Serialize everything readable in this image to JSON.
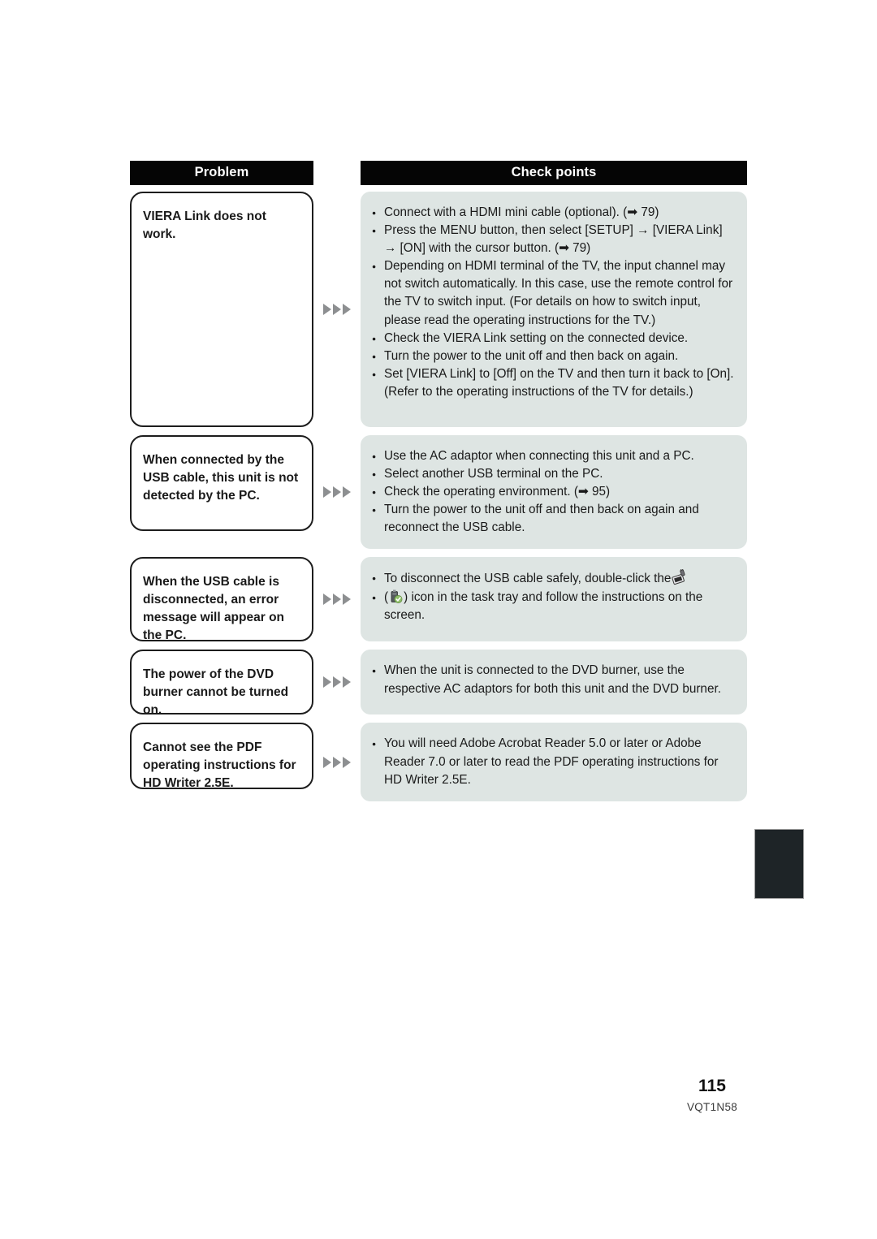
{
  "document": {
    "page_number": "115",
    "doc_code": "VQT1N58"
  },
  "table": {
    "headers": {
      "problem": "Problem",
      "check_points": "Check points"
    },
    "rows": [
      {
        "problem": "VIERA Link does not work.",
        "points": [
          "Connect with a HDMI mini cable (optional). (➡ 79)",
          "Press the MENU button, then select [SETUP] → [VIERA Link] → [ON] with the cursor button. (➡ 79)",
          "Depending on HDMI terminal of the TV, the input channel may not switch automatically. In this case, use the remote control for the TV to switch input. (For details on how to switch input, please read the operating instructions for the TV.)",
          "Check the VIERA Link setting on the connected device.",
          "Turn the power to the unit off and then back on again.",
          "Set [VIERA Link] to [Off] on the TV and then turn it back to [On]. (Refer to the operating instructions of the TV for details.)"
        ]
      },
      {
        "problem": "When connected by the USB cable, this unit is not detected by the PC.",
        "points": [
          "Use the AC adaptor when connecting this unit and a PC.",
          "Select another USB terminal on the PC.",
          "Check the operating environment. (➡ 95)",
          "Turn the power to the unit off and then back on again and reconnect the USB cable."
        ]
      },
      {
        "problem": "When the USB cable is disconnected, an error message will appear on the PC.",
        "points_split": {
          "before_icon1": "To disconnect the USB cable safely, double-click the",
          "between_icons": "(",
          "after_icon2": ") icon in the task tray and follow the instructions on the screen."
        },
        "icons": {
          "unplug": "safely-remove-hardware-icon",
          "usb_drive": "usb-drive-icon"
        }
      },
      {
        "problem": "The power of the DVD burner cannot be turned on.",
        "points": [
          "When the unit is connected to the DVD burner, use the respective AC adaptors for both this unit and the DVD burner."
        ]
      },
      {
        "problem": "Cannot see the PDF operating instructions for HD Writer 2.5E.",
        "points": [
          "You will need Adobe Acrobat Reader 5.0 or later or Adobe Reader 7.0 or later to read the PDF operating instructions for HD Writer 2.5E."
        ]
      }
    ]
  },
  "colors": {
    "header_bg": "#050505",
    "check_bg": "#dee5e3",
    "arrow_gray": "#8d8f91",
    "tab_black": "#1e2427"
  }
}
